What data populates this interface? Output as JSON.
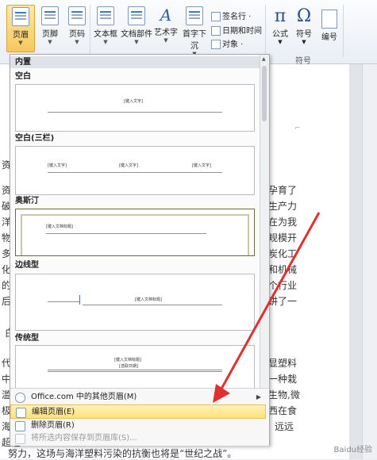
{
  "ribbon": {
    "buttons": [
      {
        "label": "页眉"
      },
      {
        "label": "页脚"
      },
      {
        "label": "页码"
      },
      {
        "label": "文本框"
      },
      {
        "label": "文档部件"
      },
      {
        "label": "艺术字"
      },
      {
        "label": "首字下沉"
      }
    ],
    "small": {
      "signature": "签名行 ·",
      "datetime": "日期和时间",
      "object": "对象 ·"
    },
    "symbols": {
      "equation_glyph": "π",
      "equation": "公式",
      "symbol_glyph": "Ω",
      "symbol": "符号",
      "number": "编号"
    },
    "group_label": "符号"
  },
  "menu": {
    "builtin": "内置",
    "galleries": [
      {
        "name": "空白",
        "ph1": "[键入文字]"
      },
      {
        "name": "空白(三栏)",
        "ph1": "[键入文字]",
        "ph2": "[键入文字]",
        "ph3": "[键入文字]"
      },
      {
        "name": "奥斯汀",
        "ph1": "[键入文档标题]"
      },
      {
        "name": "边线型",
        "ph1": "[键入文档标题]"
      },
      {
        "name": "传统型",
        "ph1": "[键入文档标题]",
        "ph2": "[选取日期]"
      }
    ],
    "items": [
      {
        "label": "Office.com 中的其他页眉(M)"
      },
      {
        "label": "编辑页眉(E)"
      },
      {
        "label": "删除页眉(R)"
      },
      {
        "label": "将所选内容保存到页眉库(S)..."
      }
    ]
  },
  "document": {
    "right_lines": [
      "孕育了",
      "生产力",
      "在为我",
      "规模开",
      "炭化工",
      "和机械",
      "个行业",
      "讲了一"
    ],
    "right_lines2": [
      "显塑料",
      "一种栽",
      "生物,微",
      "西在食",
      "远远"
    ],
    "left_frags": [
      "资源",
      "资源",
      "破坏",
      "洋,",
      "物资",
      "多亨",
      "化、",
      "的发",
      "后,",
      "白",
      "代",
      "中体",
      "滥用",
      "极小",
      "海洋",
      "超过"
    ],
    "bottom_line": "努力，这场与海洋塑料污染的抗衡也将是“世纪之战”。"
  },
  "watermark": "Baidu经验"
}
